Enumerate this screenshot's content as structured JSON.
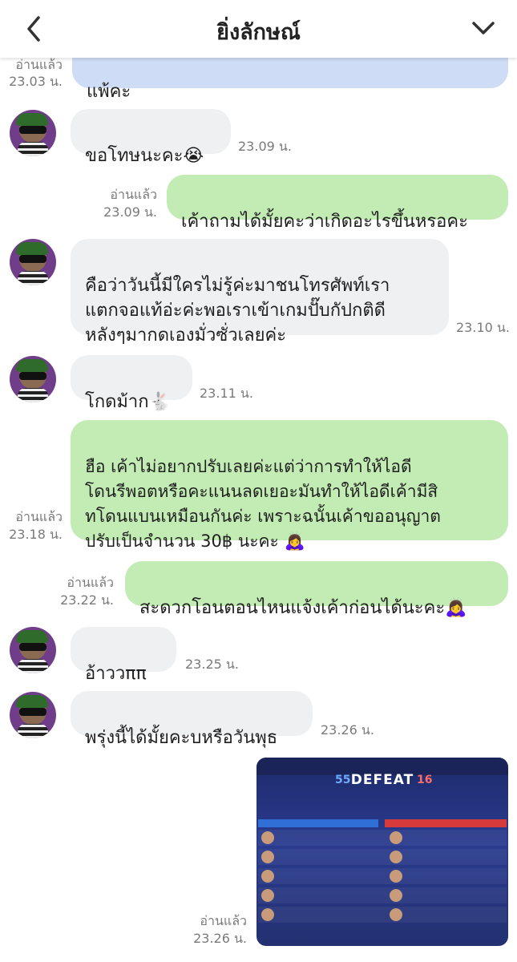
{
  "header": {
    "title": "ยิ่งลักษณ์"
  },
  "messages": [
    {
      "text": "แพ้คะ",
      "read": "อ่านแล้ว",
      "time": "23.03 น."
    },
    {
      "text": "ขอโทษนะคะ😭",
      "time": "23.09 น."
    },
    {
      "text": "เค้าถามได้มั้ยคะว่าเกิดอะไรขึ้นหรอคะ",
      "read": "อ่านแล้ว",
      "time": "23.09 น."
    },
    {
      "text": "คือว่าวันนี้มีใครไม่รู้ค่ะมาชนโทรศัพท์เรา\nแตกจอแท้อ่ะค่ะพอเราเข้าเกมปั๊บกัปกติดี\nหลังๆมากดเองมั่วซั่วเลยค่ะ",
      "time": "23.10 น."
    },
    {
      "text": "โกดม้าก🐇",
      "time": "23.11 น."
    },
    {
      "text": "ฮือ เค้าไม่อยากปรับเลยค่ะแต่ว่าการทำให้ไอดี\nโดนรีพอตหรือคะแนนลดเยอะมันทำให้ไอดีเค้ามีสิ\nทโดนแบนเหมือนกันค่ะ เพราะฉนั้นเค้าขออนุญาต\nปรับเป็นจำนวน 30฿ นะคะ 🙇‍♀️",
      "read": "อ่านแล้ว",
      "time": "23.18 น."
    },
    {
      "text": "สะดวกโอนตอนไหนแจ้งเค้าก่อนได้นะคะ🙇‍♀️",
      "read": "อ่านแล้ว",
      "time": "23.22 น."
    },
    {
      "text": "อ้าววππ",
      "time": "23.25 น."
    },
    {
      "text": "พรุ่งนี้ได้มั้ยคะบหรือวันพุธ",
      "time": "23.26 น."
    },
    {
      "read": "อ่านแล้ว",
      "time": "23.26 น."
    }
  ],
  "game_screenshot": {
    "result": "DEFEAT",
    "score_left": "55",
    "score_right": "16"
  }
}
